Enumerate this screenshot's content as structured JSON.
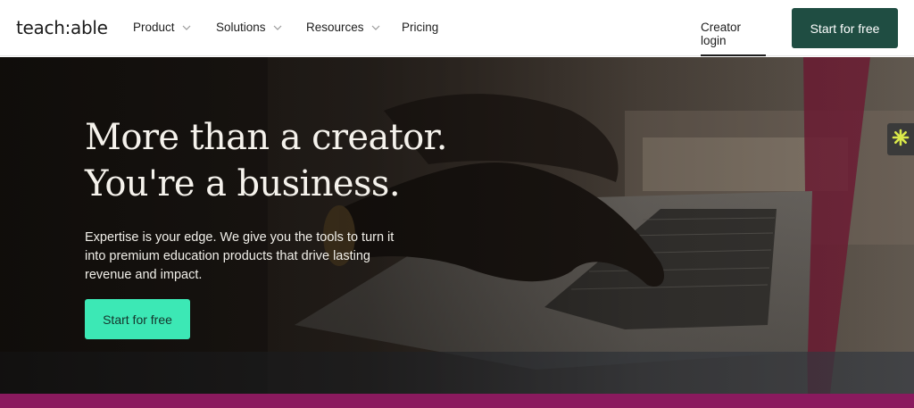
{
  "brand": {
    "logo_text": "teach:able"
  },
  "nav": {
    "items": [
      {
        "label": "Product",
        "has_dropdown": true
      },
      {
        "label": "Solutions",
        "has_dropdown": true
      },
      {
        "label": "Resources",
        "has_dropdown": true
      },
      {
        "label": "Pricing",
        "has_dropdown": false
      }
    ],
    "login_label": "Creator login",
    "cta_label": "Start for free"
  },
  "hero": {
    "headline_line1": "More than a creator.",
    "headline_line2": "You're a business.",
    "subtext": "Expertise is your edge. We give you the tools to turn it into premium education products that drive lasting revenue and impact.",
    "cta_label": "Start for free",
    "side_widget_icon": "asterisk-flower-icon"
  },
  "colors": {
    "brand_dark_green": "#1f4d42",
    "accent_mint": "#3ce8b5",
    "band_magenta": "#8a1a5e",
    "widget_yellow": "#d9e84a"
  }
}
